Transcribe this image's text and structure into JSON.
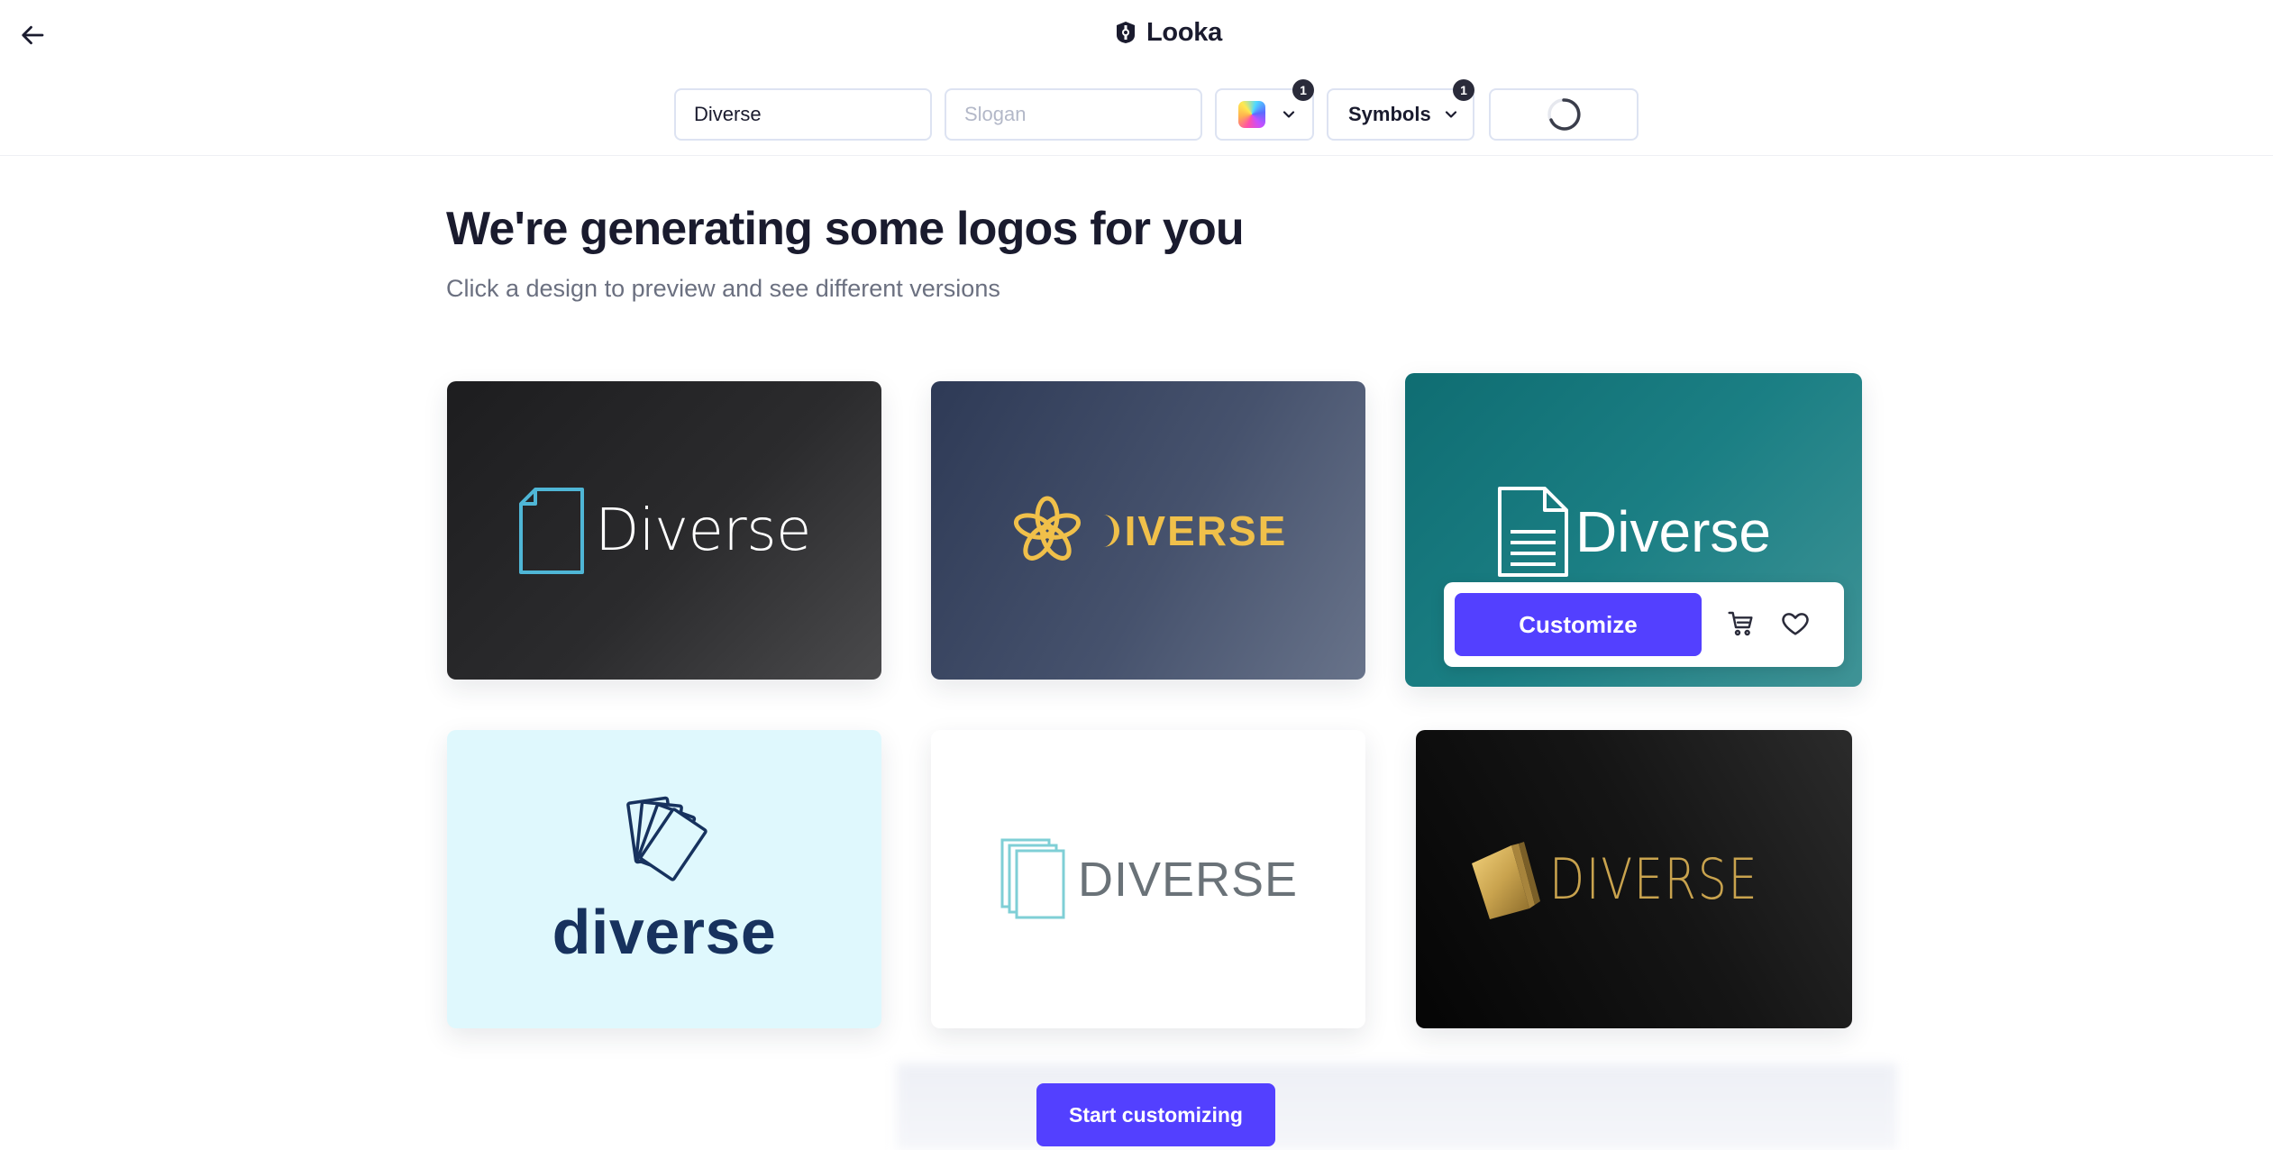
{
  "app": {
    "brand_name": "Looka"
  },
  "toolbar": {
    "name_value": "Diverse",
    "name_placeholder": "Diverse",
    "slogan_value": "",
    "slogan_placeholder": "Slogan",
    "colors_badge": "1",
    "symbols_label": "Symbols",
    "symbols_badge": "1"
  },
  "page": {
    "title": "We're generating some logos for you",
    "subtitle": "Click a design to preview and see different versions"
  },
  "logos": [
    {
      "text": "Diverse",
      "background": "dark-charcoal",
      "accent": "#4fb6d6",
      "icon": "document-icon"
    },
    {
      "text": "IVERSE",
      "background": "slate-blue",
      "accent": "#f0c04a",
      "icon": "flower-knot-icon"
    },
    {
      "text": "Diverse",
      "background": "teal",
      "accent": "#ffffff",
      "icon": "lined-document-icon"
    },
    {
      "text": "diverse",
      "background": "light-cyan",
      "accent": "#17325e",
      "icon": "fanned-cards-icon"
    },
    {
      "text": "DIVERSE",
      "background": "white",
      "accent": "#6a7278",
      "icon": "stacked-pages-icon"
    },
    {
      "text": "DIVERSE",
      "background": "black",
      "accent": "#c9a34e",
      "icon": "gold-pages-icon"
    }
  ],
  "card_actions": {
    "customize_label": "Customize"
  },
  "footer": {
    "start_label": "Start customizing"
  },
  "colors": {
    "primary": "#5340ff",
    "text": "#1a1b2e",
    "muted": "#6b7080"
  }
}
